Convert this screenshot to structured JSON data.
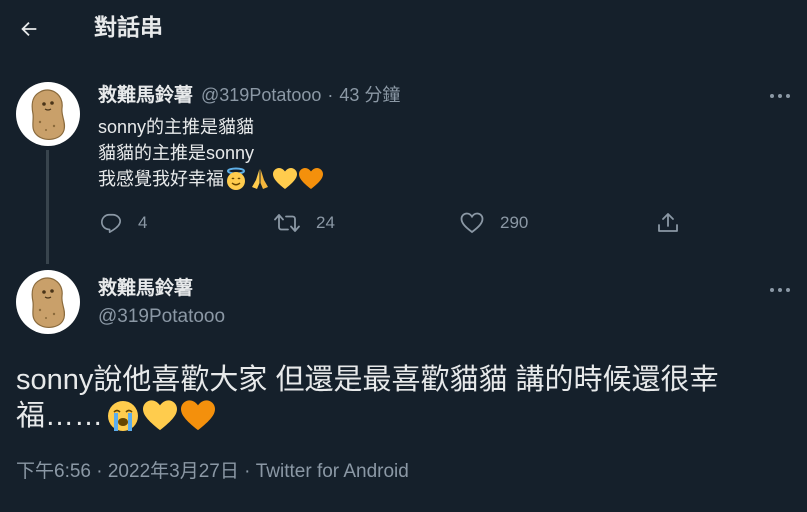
{
  "header": {
    "title": "對話串"
  },
  "tweet1": {
    "display_name": "救難馬鈴薯",
    "handle": "@319Potatooo",
    "sep": "·",
    "time": "43 分鐘",
    "lines": [
      "sonny的主推是貓貓",
      "貓貓的主推是sonny",
      "我感覺我好幸福"
    ],
    "emojis": [
      "smiling-face-with-halo",
      "folded-hands",
      "yellow-heart",
      "orange-heart"
    ],
    "replies": "4",
    "retweets": "24",
    "likes": "290"
  },
  "tweet2": {
    "display_name": "救難馬鈴薯",
    "handle": "@319Potatooo",
    "line1": "sonny說他喜歡大家 但還是最喜歡貓貓 講的時候還很幸",
    "line2": "福……",
    "emojis": [
      "loudly-crying-face",
      "yellow-heart",
      "orange-heart"
    ],
    "timestamp": "下午6:56 · 2022年3月27日 · Twitter for Android"
  },
  "colors": {
    "background": "#15202b",
    "text": "#e7e9ea",
    "muted": "#8b98a5",
    "line": "#38444d"
  }
}
